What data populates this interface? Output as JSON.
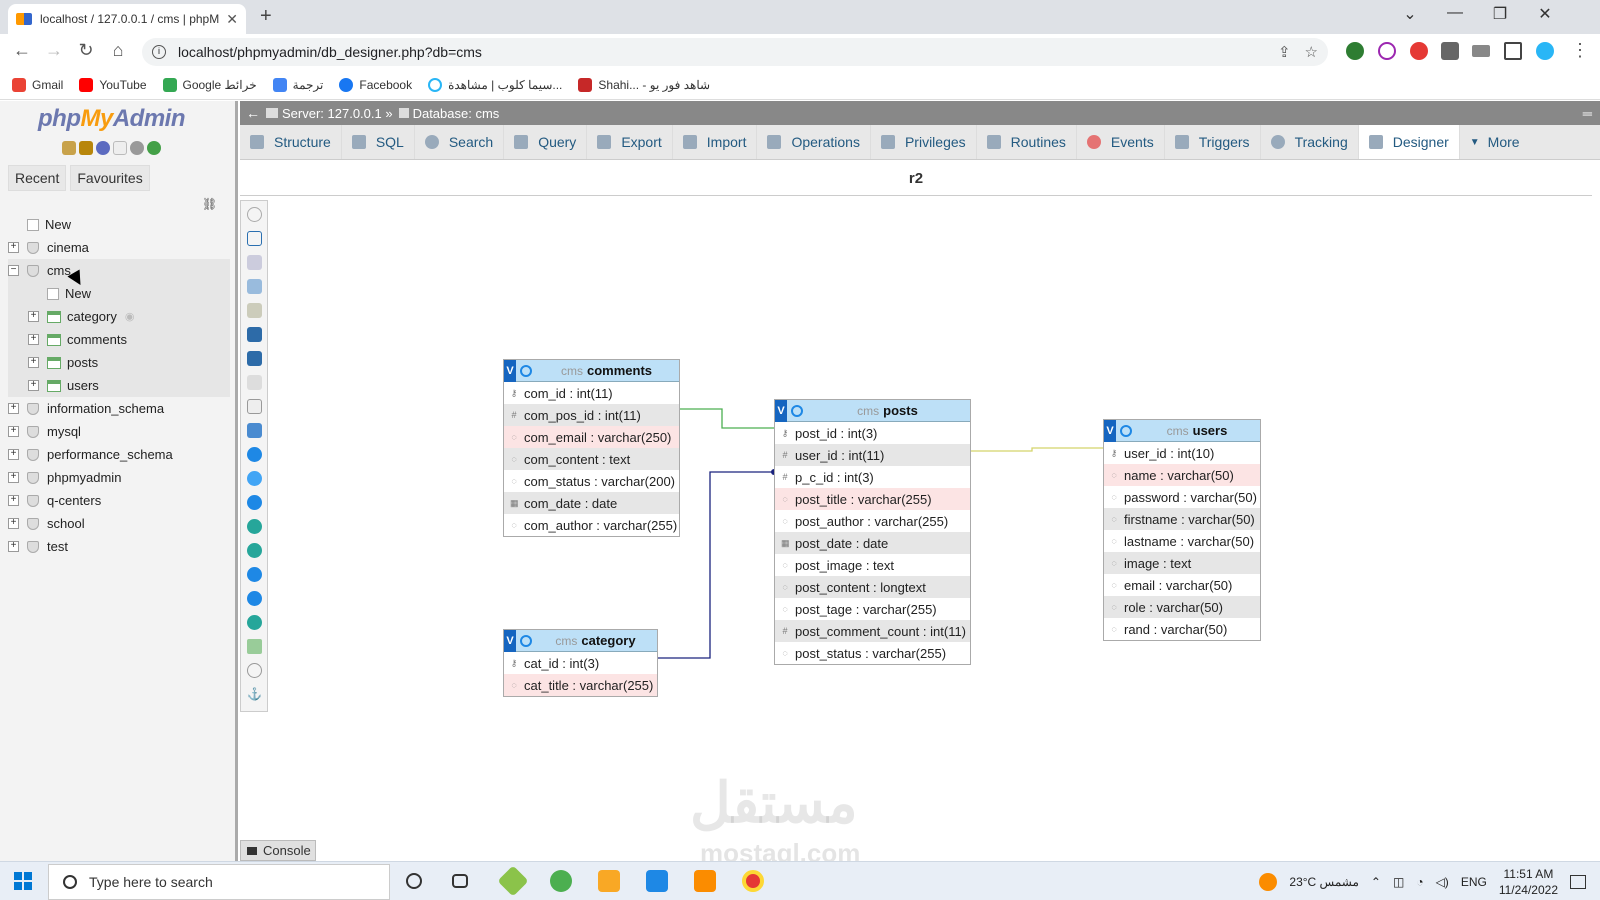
{
  "browser": {
    "tab_title": "localhost / 127.0.0.1 / cms | phpM",
    "url": "localhost/phpmyadmin/db_designer.php?db=cms",
    "bookmarks": [
      "Gmail",
      "YouTube",
      "Google خرائط",
      "ترجمة",
      "Facebook",
      "سيما كلوب | مشاهدة...",
      "Shahi... - شاهد فور يو"
    ]
  },
  "sidebar": {
    "logo_php": "php",
    "logo_my": "My",
    "logo_admin": "Admin",
    "recent_label": "Recent",
    "favourites_label": "Favourites",
    "new_label": "New",
    "databases": [
      "cinema",
      "cms",
      "information_schema",
      "mysql",
      "performance_schema",
      "phpmyadmin",
      "q-centers",
      "school",
      "test"
    ],
    "cms_children": [
      "New",
      "category",
      "comments",
      "posts",
      "users"
    ]
  },
  "breadcrumb": {
    "server": "Server: 127.0.0.1 »",
    "database": "Database: cms"
  },
  "tabs": [
    "Structure",
    "SQL",
    "Search",
    "Query",
    "Export",
    "Import",
    "Operations",
    "Privileges",
    "Routines",
    "Events",
    "Triggers",
    "Tracking",
    "Designer",
    "More"
  ],
  "active_tab": "Designer",
  "page_name": "r2",
  "designer_tables": {
    "comments": {
      "db": "cms",
      "name": "comments",
      "columns": [
        "com_id : int(11)",
        "com_pos_id : int(11)",
        "com_email : varchar(250)",
        "com_content : text",
        "com_status : varchar(200)",
        "com_date : date",
        "com_author : varchar(255)"
      ]
    },
    "posts": {
      "db": "cms",
      "name": "posts",
      "columns": [
        "post_id : int(3)",
        "user_id : int(11)",
        "p_c_id : int(3)",
        "post_title : varchar(255)",
        "post_author : varchar(255)",
        "post_date : date",
        "post_image : text",
        "post_content : longtext",
        "post_tage : varchar(255)",
        "post_comment_count : int(11)",
        "post_status : varchar(255)"
      ]
    },
    "users": {
      "db": "cms",
      "name": "users",
      "columns": [
        "user_id : int(10)",
        "name : varchar(50)",
        "password : varchar(50)",
        "firstname : varchar(50)",
        "lastname : varchar(50)",
        "image : text",
        "email : varchar(50)",
        "role : varchar(50)",
        "rand : varchar(50)"
      ]
    },
    "category": {
      "db": "cms",
      "name": "category",
      "columns": [
        "cat_id : int(3)",
        "cat_title : varchar(255)"
      ]
    }
  },
  "console_label": "Console",
  "watermark": "مستقل",
  "watermark_sub": "mostaql.com",
  "taskbar": {
    "search_placeholder": "Type here to search",
    "weather": "23°C  مشمس",
    "lang": "ENG",
    "time": "11:51 AM",
    "date": "11/24/2022"
  },
  "colors": {
    "relation_green": "#4caf50",
    "relation_blue": "#1a237e",
    "relation_yellow": "#d4d46a",
    "table_header": "#bde0f7",
    "pma_link": "#235a81"
  }
}
